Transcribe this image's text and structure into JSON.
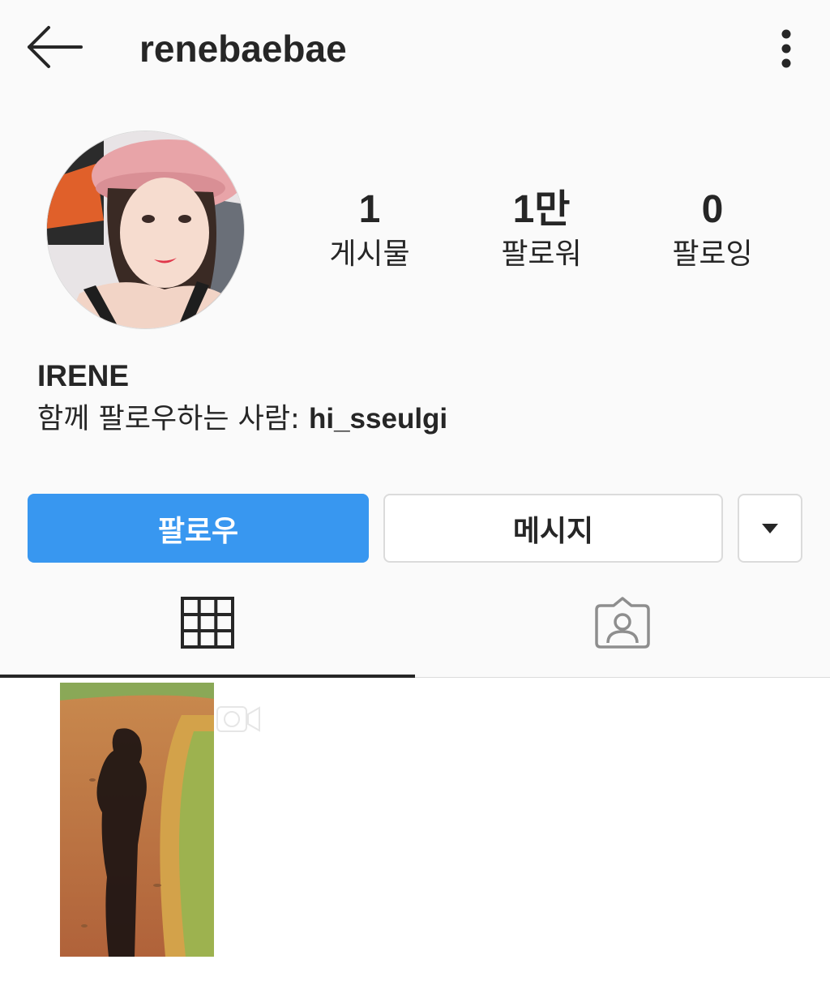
{
  "header": {
    "username": "renebaebae",
    "back_icon": "arrow-left-icon",
    "more_icon": "vertical-dots-icon"
  },
  "profile": {
    "avatar_icon": "profile-photo",
    "stats": [
      {
        "value": "1",
        "label": "게시물"
      },
      {
        "value": "1만",
        "label": "팔로워"
      },
      {
        "value": "0",
        "label": "팔로잉"
      }
    ],
    "full_name": "IRENE",
    "followed_by_prefix": "함께 팔로우하는 사람: ",
    "followed_by_user": "hi_sseulgi"
  },
  "actions": {
    "follow_label": "팔로우",
    "message_label": "메시지",
    "more_icon": "caret-down-icon"
  },
  "tabs": {
    "grid_icon": "grid-icon",
    "tagged_icon": "tagged-person-icon",
    "active": "grid"
  },
  "posts": [
    {
      "type": "video",
      "badge_icon": "video-camera-icon"
    }
  ],
  "colors": {
    "accent": "#3897f0",
    "text": "#262626",
    "border": "#dbdbdb",
    "background": "#fafafa"
  }
}
